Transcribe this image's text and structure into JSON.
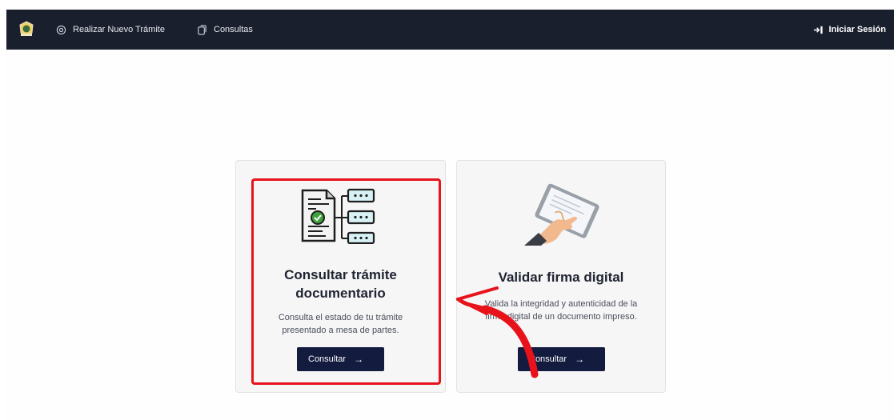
{
  "navbar": {
    "logo_icon": "crest-logo-icon",
    "items": [
      {
        "label": "Realizar Nuevo Trámite",
        "icon": "gear-icon"
      },
      {
        "label": "Consultas",
        "icon": "documents-icon"
      }
    ],
    "login": {
      "label": "Iniciar Sesión",
      "icon": "login-arrow-icon"
    },
    "background": "#1a1f2e"
  },
  "cards": [
    {
      "title": "Consultar trámite documentario",
      "description": "Consulta el estado de tu trámite presentado a mesa de partes.",
      "button_label": "Consultar",
      "button_icon": "arrow-right-icon",
      "image": "document-tracking-icon",
      "highlighted": true
    },
    {
      "title": "Validar firma digital",
      "description": "Valida la integridad y autenticidad de la firma digital de un documento impreso.",
      "button_label": "Consultar",
      "button_icon": "arrow-right-icon",
      "image": "tablet-signature-icon",
      "highlighted": false
    }
  ],
  "colors": {
    "accent": "#131b3f",
    "annotation": "#e8121b",
    "card_bg": "#f6f6f7"
  }
}
